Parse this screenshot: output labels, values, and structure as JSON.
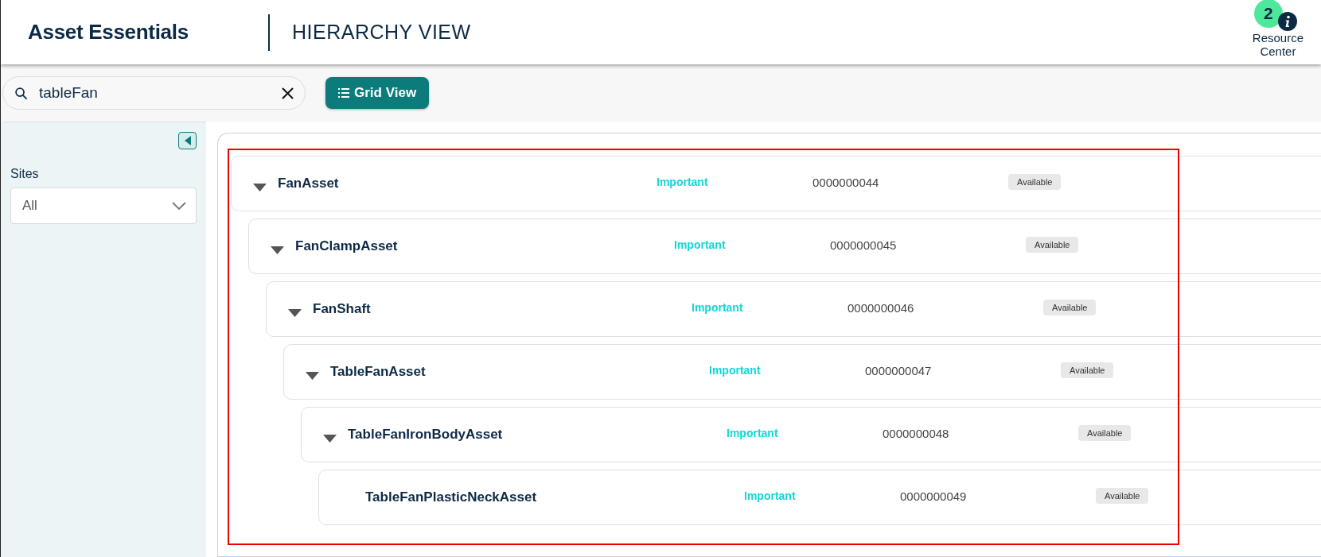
{
  "header": {
    "brand": "Asset Essentials",
    "title": "HIERARCHY VIEW",
    "resource_center": {
      "count": "2",
      "label": "Resource Center"
    }
  },
  "toolbar": {
    "search": {
      "value": "tableFan"
    },
    "grid_view_button": "Grid View"
  },
  "sidebar": {
    "collapse_button": true,
    "sites": {
      "label": "Sites",
      "value": "All"
    }
  },
  "highlight_frame": true,
  "tree": [
    {
      "name": "FanAsset",
      "priority": "Important",
      "number": "0000000044",
      "status": "Available",
      "expanded": true,
      "children": [
        {
          "name": "FanClampAsset",
          "priority": "Important",
          "number": "0000000045",
          "status": "Available",
          "expanded": true,
          "children": [
            {
              "name": "FanShaft",
              "priority": "Important",
              "number": "0000000046",
              "status": "Available",
              "expanded": true,
              "children": [
                {
                  "name": "TableFanAsset",
                  "priority": "Important",
                  "number": "0000000047",
                  "status": "Available",
                  "expanded": true,
                  "children": [
                    {
                      "name": "TableFanIronBodyAsset",
                      "priority": "Important",
                      "number": "0000000048",
                      "status": "Available",
                      "expanded": true,
                      "children": [
                        {
                          "name": "TableFanPlasticNeckAsset",
                          "priority": "Important",
                          "number": "0000000049",
                          "status": "Available"
                        }
                      ]
                    }
                  ]
                }
              ]
            }
          ]
        }
      ]
    }
  ]
}
